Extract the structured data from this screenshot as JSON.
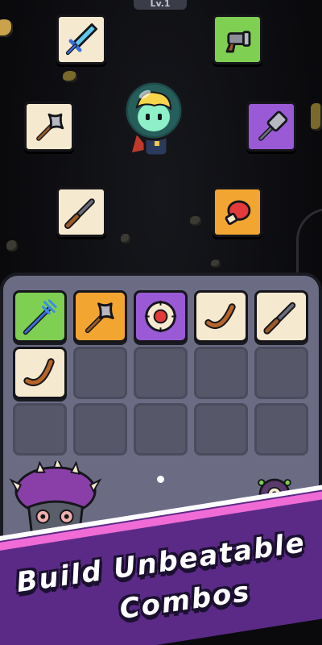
{
  "hud": {
    "level_label": "Lv.1"
  },
  "orbit_weapons": [
    {
      "name": "ice-sword-icon",
      "color": "#f5e9cf"
    },
    {
      "name": "blaster-icon",
      "color": "#7fcf52"
    },
    {
      "name": "battle-axe-icon",
      "color": "#f5e9cf"
    },
    {
      "name": "war-hammer-icon",
      "color": "#9a5ad6"
    },
    {
      "name": "shotgun-icon",
      "color": "#f5e9cf"
    },
    {
      "name": "boxing-glove-icon",
      "color": "#f2a531"
    }
  ],
  "inventory": {
    "rows": 3,
    "columns": 5,
    "items": [
      {
        "name": "trident-icon",
        "color": "#7fcf52"
      },
      {
        "name": "battle-axe-icon",
        "color": "#f2a531"
      },
      {
        "name": "target-orb-icon",
        "color": "#9a5ad6"
      },
      {
        "name": "boomerang-icon",
        "color": "#f5e9cf"
      },
      {
        "name": "shotgun-icon",
        "color": "#f5e9cf"
      },
      {
        "name": "boomerang-icon",
        "color": "#f5e9cf"
      }
    ],
    "page_indicator": {
      "pages": 1,
      "current": 1
    }
  },
  "banner": {
    "line1": "Build Unbeatable",
    "line2": "Combos"
  },
  "colors": {
    "banner_purple": "#5b2a86",
    "banner_pink": "#f06bd6",
    "panel": "#6b6c84"
  }
}
